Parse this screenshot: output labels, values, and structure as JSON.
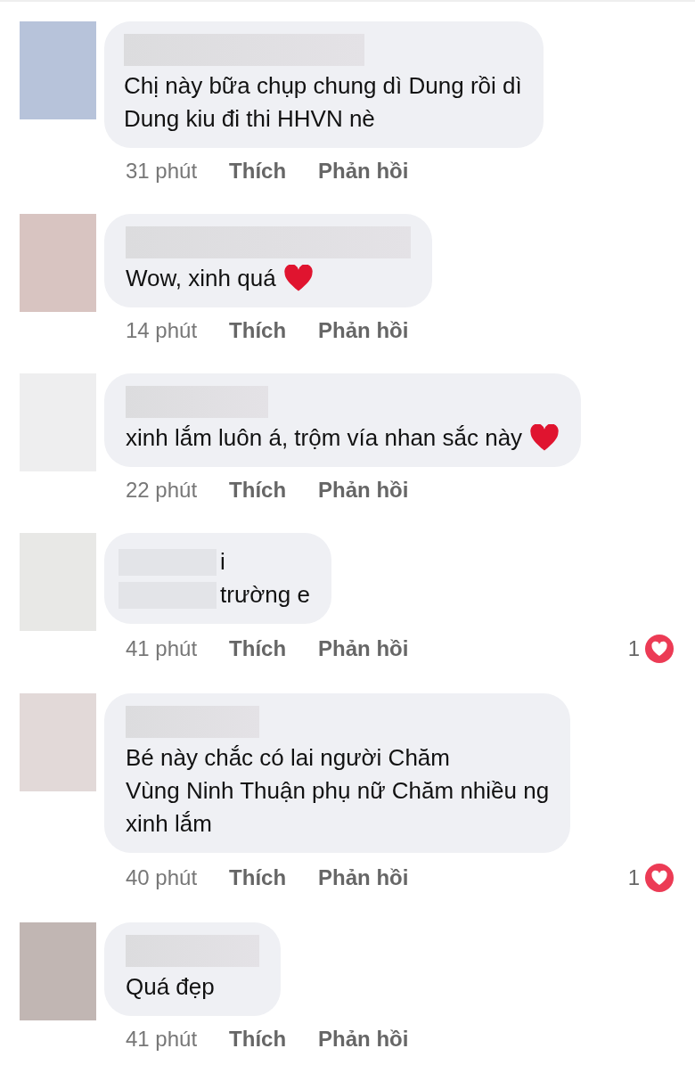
{
  "comments": [
    {
      "color": "#b7c3da",
      "lines": [
        "Chị này bữa chụp chung dì Dung rồi dì",
        "Dung kiu đi thi HHVN nè"
      ],
      "heart": false,
      "time": "31 phút",
      "like": "Thích",
      "reply": "Phản hồi"
    },
    {
      "color": "#d8c4c1",
      "lines": [
        "Wow, xinh quá"
      ],
      "heart": true,
      "time": "14 phút",
      "like": "Thích",
      "reply": "Phản hồi"
    },
    {
      "color": "#eeeeef",
      "lines": [
        "xinh lắm luôn á, trộm vía nhan sắc này"
      ],
      "heart": true,
      "time": "22 phút",
      "like": "Thích",
      "reply": "Phản hồi"
    },
    {
      "color": "#e8e8e6",
      "lines": [
        "i",
        "trường e"
      ],
      "heart": false,
      "time": "41 phút",
      "like": "Thích",
      "reply": "Phản hồi",
      "reactions": "1"
    },
    {
      "color": "#e2d9d8",
      "lines": [
        "Bé này chắc có lai người Chăm",
        "Vùng Ninh Thuận phụ nữ Chăm nhiều ng",
        "xinh lắm"
      ],
      "heart": false,
      "time": "40 phút",
      "like": "Thích",
      "reply": "Phản hồi",
      "reactions": "1"
    },
    {
      "color": "#c1b6b3",
      "lines": [
        "Quá đẹp"
      ],
      "heart": false,
      "time": "41 phút",
      "like": "Thích",
      "reply": "Phản hồi"
    }
  ]
}
